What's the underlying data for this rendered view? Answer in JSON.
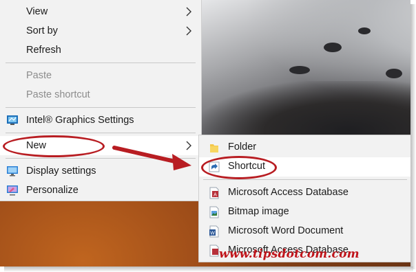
{
  "context_menu": {
    "items": [
      {
        "label": "View",
        "submenu": true,
        "disabled": false
      },
      {
        "label": "Sort by",
        "submenu": true,
        "disabled": false
      },
      {
        "label": "Refresh",
        "submenu": false,
        "disabled": false
      },
      {
        "label": "Paste",
        "submenu": false,
        "disabled": true
      },
      {
        "label": "Paste shortcut",
        "submenu": false,
        "disabled": true
      },
      {
        "label": "Intel® Graphics Settings",
        "submenu": false,
        "disabled": false,
        "icon": "intel-graphics-icon"
      },
      {
        "label": "New",
        "submenu": true,
        "disabled": false,
        "highlighted": true
      },
      {
        "label": "Display settings",
        "submenu": false,
        "disabled": false,
        "icon": "display-settings-icon"
      },
      {
        "label": "Personalize",
        "submenu": false,
        "disabled": false,
        "icon": "personalize-icon"
      }
    ]
  },
  "new_submenu": {
    "items": [
      {
        "label": "Folder",
        "icon": "folder-icon"
      },
      {
        "label": "Shortcut",
        "icon": "shortcut-icon",
        "highlighted": true
      },
      {
        "label": "Microsoft Access Database",
        "icon": "access-database-icon"
      },
      {
        "label": "Bitmap image",
        "icon": "bitmap-image-icon"
      },
      {
        "label": "Microsoft Word Document",
        "icon": "word-document-icon"
      },
      {
        "label": "Microsoft Access Database",
        "icon": "access-database-icon"
      }
    ]
  },
  "annotations": {
    "watermark": "www.tipsdotcom.com",
    "highlight_color": "#b81d22"
  }
}
